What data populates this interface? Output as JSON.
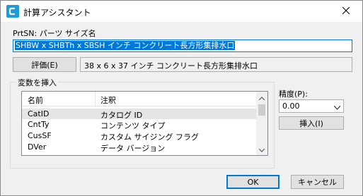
{
  "window": {
    "title": "計算アシスタント"
  },
  "name_label": "PrtSN: パーツ サイズ名",
  "name_field": {
    "value": "SHBW x SHBTh x SBSH インチ コンクリート長方形集排水口"
  },
  "evaluate_button": "評価(E)",
  "result_field": "38 x 6 x 37 インチ コンクリート長方形集排水口",
  "insert_variable": {
    "group_label": "変数を挿入",
    "columns": [
      "名前",
      "注釈"
    ],
    "rows": [
      {
        "name": "CatID",
        "note": "カタログ ID"
      },
      {
        "name": "CntTy",
        "note": "コンテンツ タイプ"
      },
      {
        "name": "CusSF",
        "note": "カスタム サイジング フラグ"
      },
      {
        "name": "DVer",
        "note": "データ バージョン"
      }
    ],
    "selected_index": 0
  },
  "precision": {
    "label": "精度(P):",
    "selected": "0.00"
  },
  "insert_button": "挿入(I)",
  "ok_button": "OK",
  "cancel_button": "キャンセル",
  "colors": {
    "accent": "#0078d7",
    "icon": "#1b9bd7"
  }
}
